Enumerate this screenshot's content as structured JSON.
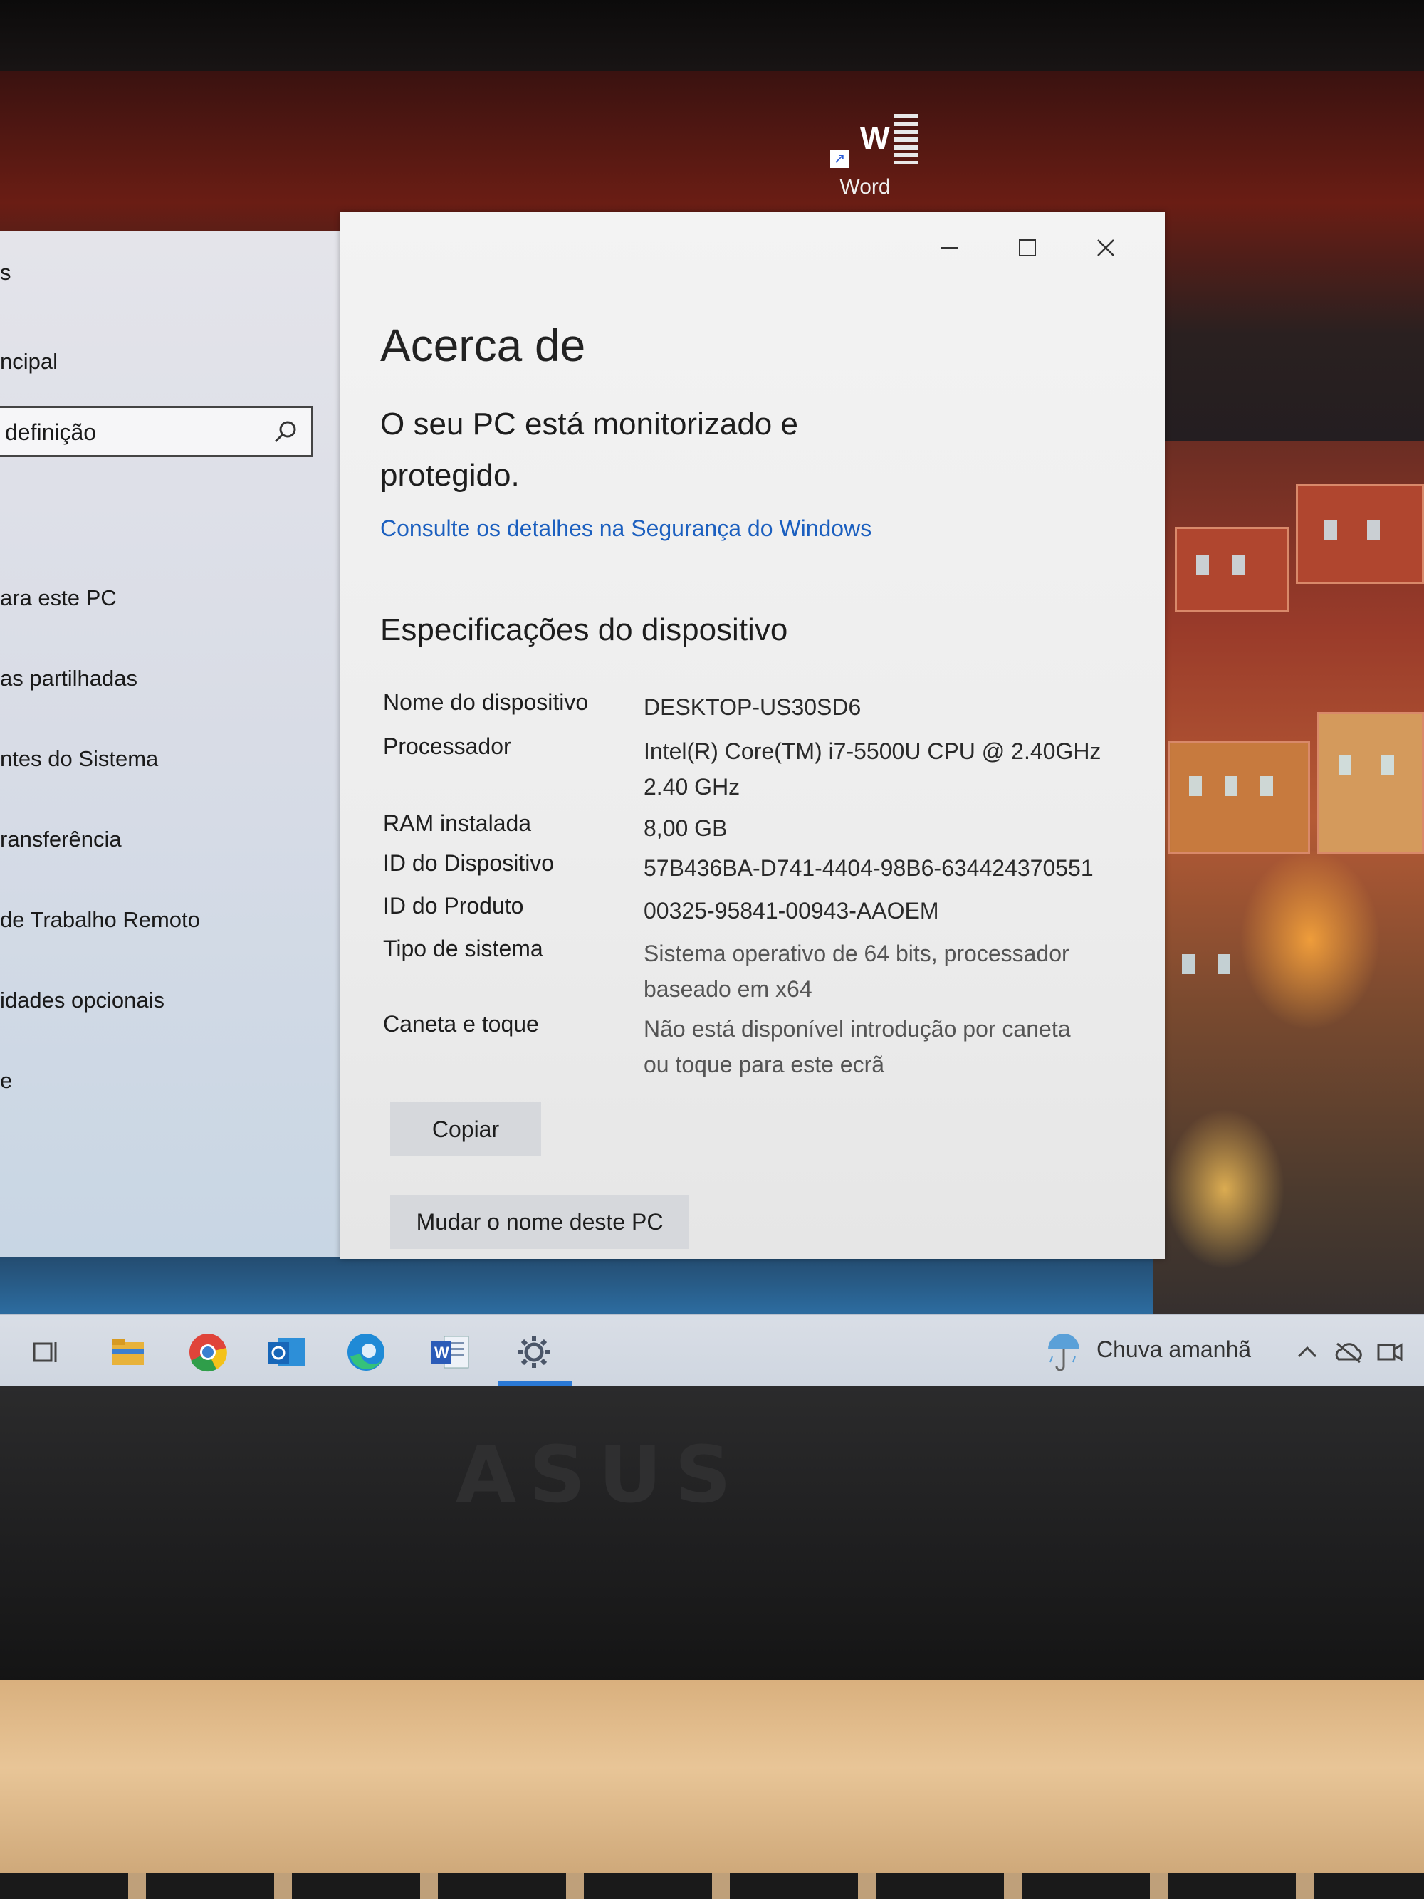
{
  "desktop": {
    "icon_label": "Word",
    "icon_letter": "W"
  },
  "settings_left": {
    "items": [
      {
        "label": "s"
      },
      {
        "label": "ncipal"
      },
      {
        "label": "ara este PC"
      },
      {
        "label": "as partilhadas"
      },
      {
        "label": "ntes do Sistema"
      },
      {
        "label": "ransferência"
      },
      {
        "label": "de Trabalho Remoto"
      },
      {
        "label": "idades opcionais"
      },
      {
        "label": "e"
      }
    ],
    "search_placeholder": "definição"
  },
  "about": {
    "title": "Acerca de",
    "status": "O seu PC está monitorizado e protegido.",
    "security_link": "Consulte os detalhes na Segurança do Windows",
    "specs_title": "Especificações do dispositivo",
    "specs": [
      {
        "key": "Nome do dispositivo",
        "value": "DESKTOP-US30SD6",
        "value2": ""
      },
      {
        "key": "Processador",
        "value": "Intel(R) Core(TM) i7-5500U CPU @ 2.40GHz",
        "value2": "2.40 GHz"
      },
      {
        "key": "RAM instalada",
        "value": "8,00 GB",
        "value2": ""
      },
      {
        "key": "ID do Dispositivo",
        "value": "57B436BA-D741-4404-98B6-634424370551",
        "value2": ""
      },
      {
        "key": "ID do Produto",
        "value": "00325-95841-00943-AAOEM",
        "value2": ""
      },
      {
        "key": "Tipo de sistema",
        "value": "Sistema operativo de 64 bits, processador",
        "value2": "baseado em x64"
      },
      {
        "key": "Caneta e toque",
        "value": "Não está disponível introdução por caneta",
        "value2": "ou toque para este ecrã"
      }
    ],
    "copy_button": "Copiar",
    "rename_button": "Mudar o nome deste PC"
  },
  "taskbar": {
    "weather": "Chuva amanhã",
    "icons": [
      "task-view-icon",
      "file-explorer-icon",
      "chrome-icon",
      "outlook-icon",
      "edge-icon",
      "word-icon",
      "settings-icon"
    ]
  },
  "laptop": {
    "brand": "ASUS"
  },
  "colors": {
    "link": "#1b5fbf",
    "taskbar_accent": "#2a79d6"
  }
}
